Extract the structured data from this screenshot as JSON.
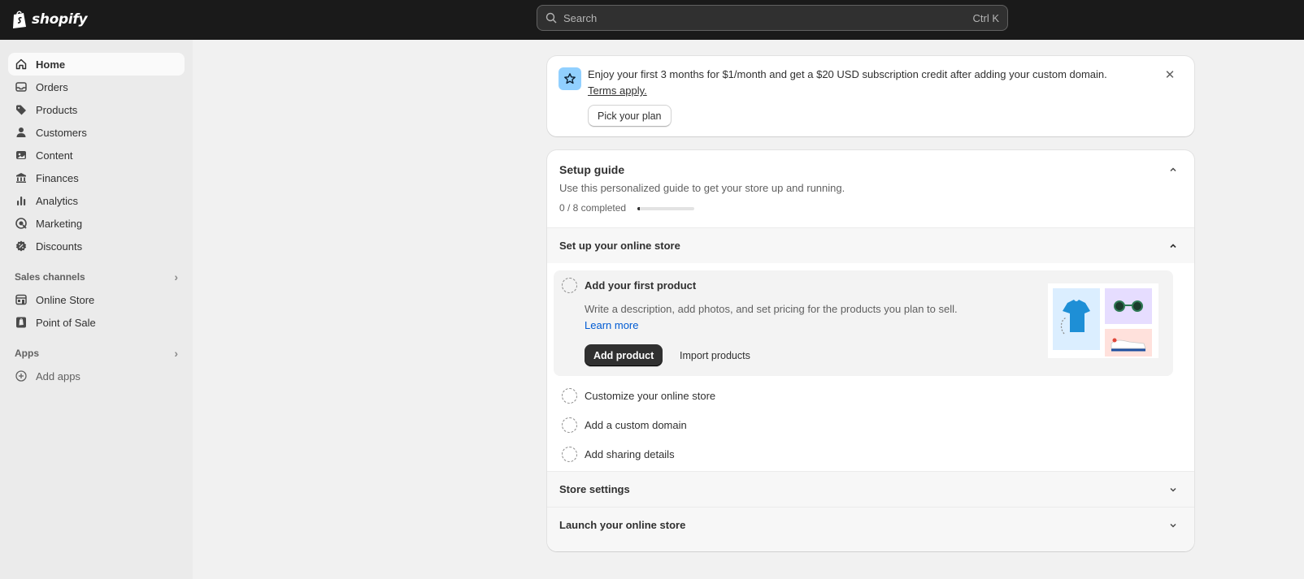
{
  "topbar": {
    "logo_text": "shopify",
    "search_placeholder": "Search",
    "search_shortcut": "Ctrl K"
  },
  "sidebar": {
    "items": [
      {
        "label": "Home",
        "icon": "home-icon"
      },
      {
        "label": "Orders",
        "icon": "inbox-icon"
      },
      {
        "label": "Products",
        "icon": "tag-icon"
      },
      {
        "label": "Customers",
        "icon": "person-icon"
      },
      {
        "label": "Content",
        "icon": "image-icon"
      },
      {
        "label": "Finances",
        "icon": "bank-icon"
      },
      {
        "label": "Analytics",
        "icon": "bar-chart-icon"
      },
      {
        "label": "Marketing",
        "icon": "target-icon"
      },
      {
        "label": "Discounts",
        "icon": "discount-icon"
      }
    ],
    "sales_channels": {
      "label": "Sales channels",
      "items": [
        {
          "label": "Online Store",
          "icon": "store-icon"
        },
        {
          "label": "Point of Sale",
          "icon": "pos-icon"
        }
      ]
    },
    "apps": {
      "label": "Apps",
      "add_label": "Add apps"
    }
  },
  "banner": {
    "message": "Enjoy your first 3 months for $1/month and get a $20 USD subscription credit after adding your custom domain.",
    "terms": "Terms apply.",
    "button": "Pick your plan"
  },
  "guide": {
    "title": "Setup guide",
    "subtitle": "Use this personalized guide to get your store up and running.",
    "progress_text": "0 / 8 completed",
    "progress_fraction": 0.0,
    "sections": [
      {
        "title": "Set up your online store",
        "expanded": true
      },
      {
        "title": "Store settings",
        "expanded": false
      },
      {
        "title": "Launch your online store",
        "expanded": false
      }
    ],
    "active_task": {
      "title": "Add your first product",
      "description": "Write a description, add photos, and set pricing for the products you plan to sell.",
      "link": "Learn more",
      "primary_button": "Add product",
      "secondary_button": "Import products"
    },
    "tasks": [
      "Customize your online store",
      "Add a custom domain",
      "Add sharing details"
    ]
  },
  "colors": {
    "topbar": "#1a1a1a",
    "sidebar": "#ebebeb",
    "page": "#f1f1f1",
    "link": "#005bd3",
    "primary_button": "#303030",
    "banner_icon_bg": "#91d0ff"
  }
}
